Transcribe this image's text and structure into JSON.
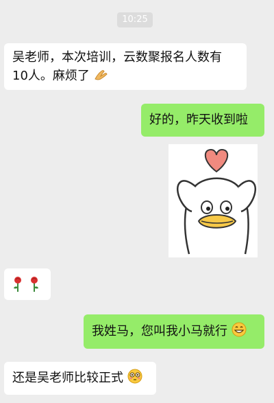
{
  "chat": {
    "timestamp": "10:25",
    "messages": [
      {
        "side": "incoming",
        "text_line1": "吴老师，本次培训，云数聚报名人数有",
        "text_line2": "10人。麻烦了",
        "emoji": "folded-hands-icon"
      },
      {
        "side": "outgoing",
        "text": "好的，昨天收到啦"
      },
      {
        "side": "outgoing",
        "sticker": "duck-heart-sticker"
      },
      {
        "side": "incoming",
        "emoji": "rose-icon"
      },
      {
        "side": "outgoing",
        "text": "我姓马，您叫我小马就行",
        "emoji": "grinning-face-icon"
      },
      {
        "side": "incoming",
        "text": "还是吴老师比较正式",
        "emoji": "flushed-face-icon"
      }
    ]
  },
  "colors": {
    "background": "#ededed",
    "incoming_bubble": "#ffffff",
    "outgoing_bubble": "#95ec69"
  }
}
